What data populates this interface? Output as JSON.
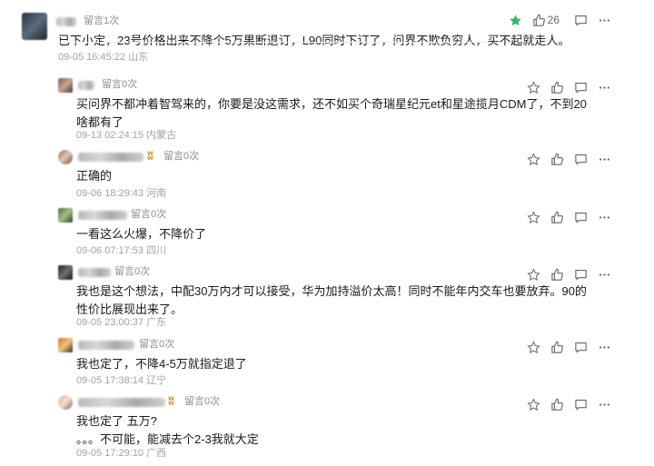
{
  "top": {
    "reply_label": "留言1次",
    "text": "已下小定，23号价格出来不降个5万果断退订，L90同时下订了，问界不欺负穷人，买不起就走人。",
    "time": "09-05 16:45:22",
    "location": "山东",
    "like_count": "26",
    "starred": true,
    "star_color": "#2dbb6b"
  },
  "replies": [
    {
      "reply_label": "留言0次",
      "text": "买问界不都冲着智驾来的，你要是没这需求，还不如买个奇瑞星纪元et和星途揽月CDM了，不到20\n啥都有了",
      "time": "09-13 02:24:15",
      "location": "内蒙古"
    },
    {
      "reply_label": "留言0次",
      "text": "正确的",
      "time": "09-06 18:29:43",
      "location": "河南"
    },
    {
      "reply_label": "留言0次",
      "text": "一看这么火爆，不降价了",
      "time": "09-06 07:17:53",
      "location": "四川"
    },
    {
      "reply_label": "留言0次",
      "text": "我也是这个想法，中配30万内才可以接受，华为加持溢价太高！同时不能年内交车也要放弃。90的\n性价比展现出来了。",
      "time": "09-05 23:00:37",
      "location": "广东"
    },
    {
      "reply_label": "留言0次",
      "text": "我也定了，不降4-5万就指定退了",
      "time": "09-05 17:38:14",
      "location": "辽宁"
    },
    {
      "reply_label": "留言0次",
      "text": "我也定了 五万?\n。。。不可能，能减去个2-3我就大定",
      "time": "09-05 17:29:10",
      "location": "广西"
    }
  ],
  "icons": {
    "star": "star-icon",
    "like": "thumbs-up-icon",
    "comment": "comment-icon",
    "more": "more-icon"
  }
}
